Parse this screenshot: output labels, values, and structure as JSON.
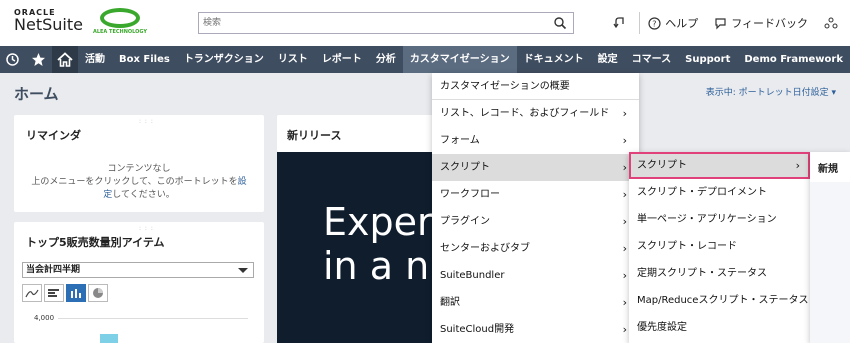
{
  "brand": {
    "oracle": "ORACLE",
    "netsuite": "NetSuite",
    "partner_text": "ALEA TECHNOLOGY"
  },
  "search": {
    "placeholder": "検索"
  },
  "top_icons": {
    "help": "ヘルプ",
    "feedback": "フィードバック"
  },
  "nav": {
    "items": [
      "活動",
      "Box Files",
      "トランザクション",
      "リスト",
      "レポート",
      "分析",
      "カスタマイゼーション",
      "ドキュメント",
      "設定",
      "コマース",
      "Support",
      "Demo Framework"
    ]
  },
  "page": {
    "title": "ホーム",
    "view_pref": "表示中: ポートレット日付設定"
  },
  "reminders": {
    "title": "リマインダ",
    "empty": "コンテンツなし",
    "msg_before": "上のメニューをクリックして、このポートレットを",
    "msg_link1": "設",
    "msg_link2": "定",
    "msg_after": "してください。"
  },
  "top_items": {
    "title": "トップ5販売数量別アイテム",
    "period": "当会計四半期",
    "y_tick": "4,000"
  },
  "release": {
    "title": "新リリース",
    "line1": "Exper",
    "line2": "in a n"
  },
  "menu_customization": {
    "items": [
      {
        "label": "カスタマイゼーションの概要",
        "has_sub": false
      },
      {
        "label": "リスト、レコード、およびフィールド",
        "has_sub": true
      },
      {
        "label": "フォーム",
        "has_sub": true
      },
      {
        "label": "スクリプト",
        "has_sub": true
      },
      {
        "label": "ワークフロー",
        "has_sub": true
      },
      {
        "label": "プラグイン",
        "has_sub": true
      },
      {
        "label": "センターおよびタブ",
        "has_sub": true
      },
      {
        "label": "SuiteBundler",
        "has_sub": true
      },
      {
        "label": "翻訳",
        "has_sub": true
      },
      {
        "label": "SuiteCloud開発",
        "has_sub": true
      }
    ]
  },
  "menu_script": {
    "items": [
      {
        "label": "スクリプト",
        "has_sub": true
      },
      {
        "label": "スクリプト・デプロイメント",
        "has_sub": false
      },
      {
        "label": "単一ページ・アプリケーション",
        "has_sub": false
      },
      {
        "label": "スクリプト・レコード",
        "has_sub": false
      },
      {
        "label": "定期スクリプト・ステータス",
        "has_sub": false
      },
      {
        "label": "Map/Reduceスクリプト・ステータス",
        "has_sub": false
      },
      {
        "label": "優先度設定",
        "has_sub": false
      }
    ]
  },
  "menu_new": {
    "title": "新規"
  },
  "colors": {
    "nav_bg": "#3f4d60",
    "highlight_border": "#e0417a",
    "chart_bar": "#7ed0e6",
    "link": "#2d5f9a"
  }
}
